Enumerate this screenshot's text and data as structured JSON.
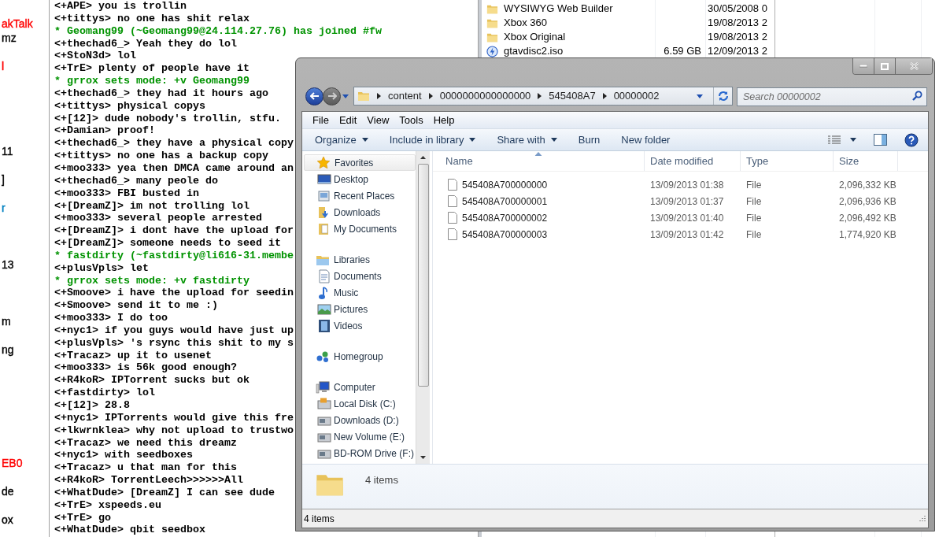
{
  "nick_list": [
    {
      "text": "akTalk",
      "color": "#ff0000"
    },
    {
      "text": "mz",
      "color": "#000000"
    },
    {
      "text": "l",
      "color": "#ff0000"
    },
    {
      "text": "11",
      "color": "#000000"
    },
    {
      "text": "]",
      "color": "#000000"
    },
    {
      "text": "r",
      "color": "#0080c0"
    },
    {
      "text": "13",
      "color": "#000000"
    },
    {
      "text": "m",
      "color": "#000000"
    },
    {
      "text": "ng",
      "color": "#000000"
    },
    {
      "text": "EB0",
      "color": "#ff0000"
    },
    {
      "text": "de",
      "color": "#000000"
    },
    {
      "text": "ox",
      "color": "#000000"
    }
  ],
  "chat": {
    "lines": [
      {
        "kind": "message",
        "text": "<+APE> you is trollin"
      },
      {
        "kind": "message",
        "text": "<+tittys> no one has shit relax"
      },
      {
        "kind": "event",
        "text": "* Geomang99 (~Geomang99@24.114.27.76) has joined #fw"
      },
      {
        "kind": "message",
        "text": "<+thechad6_> Yeah they do lol"
      },
      {
        "kind": "message",
        "text": "<+StoN3d> lol"
      },
      {
        "kind": "message",
        "text": "<+TrE> plenty of people have it"
      },
      {
        "kind": "event",
        "text": "* grrox sets mode: +v Geomang99"
      },
      {
        "kind": "message",
        "text": "<+thechad6_> they had it hours ago"
      },
      {
        "kind": "message",
        "text": "<+tittys> physical copys"
      },
      {
        "kind": "message",
        "text": "<+[12]> dude nobody's trollin, stfu."
      },
      {
        "kind": "message",
        "text": "<+Damian> proof!"
      },
      {
        "kind": "message",
        "text": "<+thechad6_> they have a physical copy"
      },
      {
        "kind": "message",
        "text": "<+tittys> no one has a backup copy"
      },
      {
        "kind": "message",
        "text": "<+moo333> yea then DMCA came around an"
      },
      {
        "kind": "message",
        "text": "<+thechad6_> many peole do"
      },
      {
        "kind": "message",
        "text": "<+moo333> FBI busted in"
      },
      {
        "kind": "message",
        "text": "<+[DreamZ]> im not trolling lol"
      },
      {
        "kind": "message",
        "text": "<+moo333> several people arrested"
      },
      {
        "kind": "message",
        "text": "<+[DreamZ]> i dont have the upload for"
      },
      {
        "kind": "message",
        "text": "<+[DreamZ]> someone needs to seed it"
      },
      {
        "kind": "event",
        "text": "* fastdirty (~fastdirty@li616-31.membe"
      },
      {
        "kind": "message",
        "text": "<+plusVpls> let"
      },
      {
        "kind": "event",
        "text": "* grrox sets mode: +v fastdirty"
      },
      {
        "kind": "message",
        "text": "<+Smoove> i have the upload for seedin"
      },
      {
        "kind": "message",
        "text": "<+Smoove> send it to me :)"
      },
      {
        "kind": "message",
        "text": "<+moo333> I do too"
      },
      {
        "kind": "message",
        "text": "<+nyc1> if you guys would have just up"
      },
      {
        "kind": "message",
        "text": "<+plusVpls> 's rsync this shit to my s"
      },
      {
        "kind": "message",
        "text": "<+Tracaz> up it to usenet"
      },
      {
        "kind": "message",
        "text": "<+moo333> is 56k good enough?"
      },
      {
        "kind": "message",
        "text": "<+R4koR> IPTorrent sucks but ok"
      },
      {
        "kind": "message",
        "text": "<+fastdirty> lol"
      },
      {
        "kind": "message",
        "text": "<+[12]> 28.8"
      },
      {
        "kind": "message",
        "text": "<+nyc1> IPTorrents would give this fre"
      },
      {
        "kind": "message",
        "text": "<+lkwrnklea> why not upload to trustwo"
      },
      {
        "kind": "message",
        "text": "<+Tracaz> we need this dreamz"
      },
      {
        "kind": "message",
        "text": "<+nyc1> with seedboxes"
      },
      {
        "kind": "message",
        "text": "<+Tracaz> u that man for this"
      },
      {
        "kind": "message",
        "text": "<+R4koR> TorrentLeech>>>>>>All"
      },
      {
        "kind": "message",
        "text": "<+WhatDude> [DreamZ] I can see dude"
      },
      {
        "kind": "message",
        "text": "<+TrE> xspeeds.eu"
      },
      {
        "kind": "message",
        "text": "<+TrE> go"
      },
      {
        "kind": "message",
        "text": "<+WhatDude> qbit seedbox"
      }
    ]
  },
  "background_window": {
    "rows": [
      {
        "kind": "folder",
        "name": "WYSIWYG Web Builder",
        "date": "30/05/2008 0"
      },
      {
        "kind": "folder",
        "name": "Xbox 360",
        "date": "19/08/2013 2"
      },
      {
        "kind": "folder",
        "name": "Xbox Original",
        "date": "19/08/2013 2"
      },
      {
        "kind": "disc",
        "name": "gtavdisc2.iso",
        "size": "6.59 GB",
        "date": "12/09/2013 2"
      }
    ]
  },
  "explorer": {
    "address": {
      "path": [
        "content",
        "0000000000000000",
        "545408A7",
        "00000002"
      ]
    },
    "search": {
      "placeholder": "Search 00000002"
    },
    "menu": [
      "File",
      "Edit",
      "View",
      "Tools",
      "Help"
    ],
    "toolbar": [
      {
        "label": "Organize",
        "dropdown": true
      },
      {
        "label": "Include in library",
        "dropdown": true
      },
      {
        "label": "Share with",
        "dropdown": true
      },
      {
        "label": "Burn",
        "dropdown": false
      },
      {
        "label": "New folder",
        "dropdown": false
      }
    ],
    "nav": [
      {
        "label": "Favorites",
        "children": [
          {
            "label": "Desktop"
          },
          {
            "label": "Recent Places"
          },
          {
            "label": "Downloads"
          },
          {
            "label": "My Documents"
          }
        ]
      },
      {
        "label": "Libraries",
        "children": [
          {
            "label": "Documents"
          },
          {
            "label": "Music"
          },
          {
            "label": "Pictures"
          },
          {
            "label": "Videos"
          }
        ]
      },
      {
        "label": "Homegroup"
      },
      {
        "label": "Computer",
        "children": [
          {
            "label": "Local Disk (C:)"
          },
          {
            "label": "Downloads (D:)"
          },
          {
            "label": "New Volume (E:)"
          },
          {
            "label": "BD-ROM Drive (F:)"
          }
        ]
      }
    ],
    "columns": [
      {
        "label": "Name",
        "sorted": true
      },
      {
        "label": "Date modified",
        "sorted": false
      },
      {
        "label": "Type",
        "sorted": false
      },
      {
        "label": "Size",
        "sorted": false
      }
    ],
    "files": [
      {
        "name": "545408A700000000",
        "date": "13/09/2013 01:38",
        "type": "File",
        "size": "2,096,332 KB"
      },
      {
        "name": "545408A700000001",
        "date": "13/09/2013 01:37",
        "type": "File",
        "size": "2,096,936 KB"
      },
      {
        "name": "545408A700000002",
        "date": "13/09/2013 01:40",
        "type": "File",
        "size": "2,096,492 KB"
      },
      {
        "name": "545408A700000003",
        "date": "13/09/2013 01:42",
        "type": "File",
        "size": "1,774,920 KB"
      }
    ],
    "details": "4 items",
    "status": "4 items"
  }
}
